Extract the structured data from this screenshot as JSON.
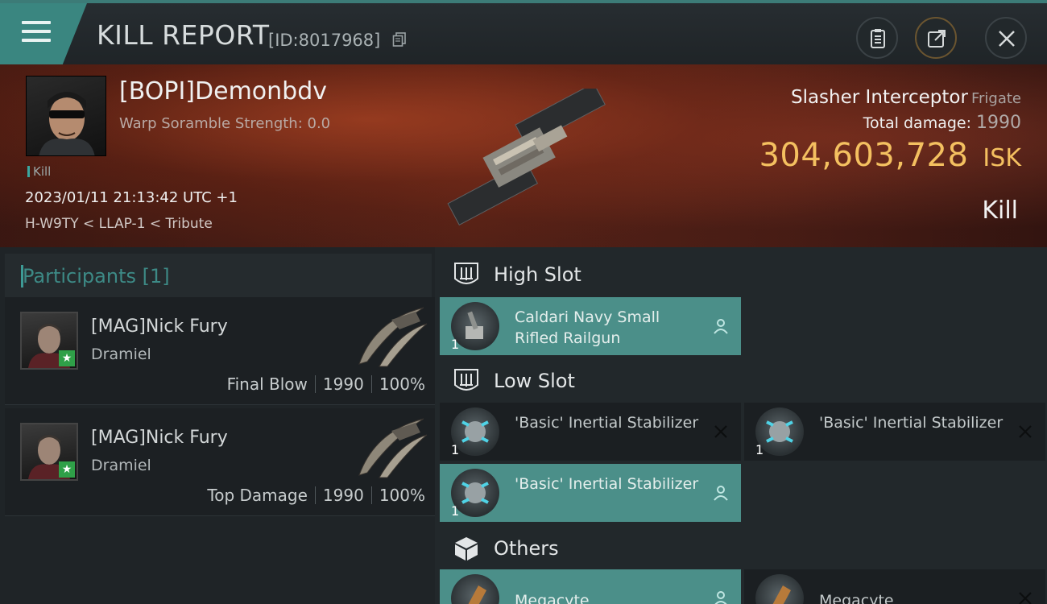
{
  "header": {
    "title": "KILL REPORT",
    "report_id": "[ID:8017968]"
  },
  "victim": {
    "name": "[BOPI]Demonbdv",
    "warp_scramble": "Warp Soramble Strength: 0.0",
    "kill_tag": "Kill",
    "timestamp": "2023/01/11 21:13:42 UTC +1",
    "location": "H-W9TY < LLAP-1 < Tribute",
    "ship_name": "Slasher Interceptor",
    "ship_class": "Frigate",
    "total_damage_label": "Total damage:",
    "total_damage": "1990",
    "isk_value": "304,603,728",
    "isk_unit": "ISK",
    "result": "Kill"
  },
  "participants": {
    "title": "Participants [1]",
    "rows": [
      {
        "name": "[MAG]Nick Fury",
        "ship": "Dramiel",
        "role": "Final Blow",
        "damage": "1990",
        "percent": "100%"
      },
      {
        "name": "[MAG]Nick Fury",
        "ship": "Dramiel",
        "role": "Top Damage",
        "damage": "1990",
        "percent": "100%"
      }
    ]
  },
  "fitting": {
    "high_slot": {
      "title": "High Slot",
      "items": [
        {
          "name": "Caldari Navy Small Rifled Railgun",
          "qty": "1",
          "status": "dropped"
        }
      ]
    },
    "low_slot": {
      "title": "Low Slot",
      "items": [
        {
          "name": "'Basic' Inertial Stabilizer",
          "qty": "1",
          "status": "destroyed"
        },
        {
          "name": "'Basic' Inertial Stabilizer",
          "qty": "1",
          "status": "destroyed"
        },
        {
          "name": "'Basic' Inertial Stabilizer",
          "qty": "1",
          "status": "dropped"
        }
      ]
    },
    "others": {
      "title": "Others",
      "items": [
        {
          "name": "Megacyte",
          "qty": "",
          "status": "dropped"
        },
        {
          "name": "Megacyte",
          "qty": "",
          "status": "destroyed"
        }
      ]
    }
  },
  "colors": {
    "accent_teal": "#3a8680",
    "dropped_bg": "#4b8f89",
    "isk_gold": "#f4c060"
  }
}
